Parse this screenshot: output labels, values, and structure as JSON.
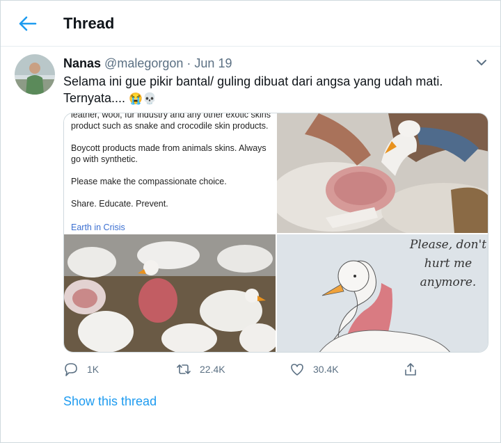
{
  "header": {
    "title": "Thread",
    "back_icon": "arrow-left-icon"
  },
  "tweet": {
    "name": "Nanas",
    "handle": "@malegorgon",
    "dot": "·",
    "date": "Jun 19",
    "text": "Selama ini gue pikir bantal/ guling dibuat dari angsa yang udah mati. Ternyata....",
    "emoji": "😭💀",
    "media": {
      "text_tile": {
        "line1": "leather, wool, fur industry and any other exotic skins product such as snake and crocodile skin products.",
        "line2": "Boycott products made from animals skins. Always go with synthetic.",
        "line3": "Please make the compassionate choice.",
        "line4": "Share. Educate. Prevent.",
        "link": "Earth in Crisis"
      },
      "drawing_text": "Please, don't hurt me anymore."
    },
    "actions": {
      "reply_count": "1K",
      "retweet_count": "22.4K",
      "like_count": "30.4K"
    },
    "show_thread": "Show this thread"
  },
  "colors": {
    "accent": "#1d9bf0",
    "muted": "#5b7083",
    "border": "#cfd9de"
  }
}
